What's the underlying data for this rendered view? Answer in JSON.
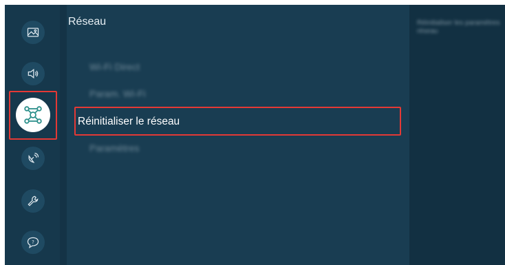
{
  "sidebar": {
    "items": [
      {
        "icon": "picture-icon"
      },
      {
        "icon": "sound-icon"
      },
      {
        "icon": "network-icon",
        "active": true
      },
      {
        "icon": "broadcast-icon"
      },
      {
        "icon": "support-wrench-icon"
      },
      {
        "icon": "help-chat-icon"
      }
    ]
  },
  "main": {
    "title": "Réseau",
    "menu": [
      {
        "label": "Wi-Fi Direct"
      },
      {
        "label": "Param. Wi-Fi"
      },
      {
        "label": "Réinitialiser le réseau",
        "selected": true
      },
      {
        "label": "Paramètres"
      }
    ]
  },
  "right_panel": {
    "lines": [
      "Réinitialiser les paramètres",
      "réseau"
    ]
  },
  "colors": {
    "background": "#173a4e",
    "highlight": "#e53935",
    "active_icon_bg": "#ffffff"
  }
}
